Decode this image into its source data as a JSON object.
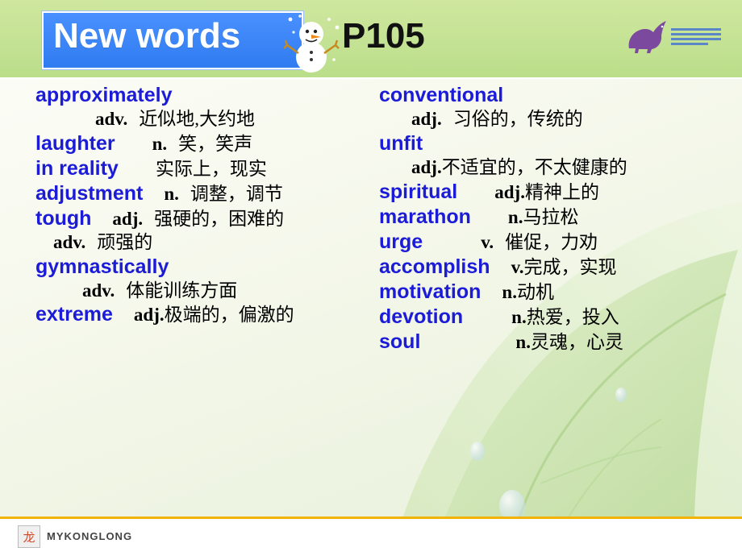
{
  "header": {
    "title": "New words",
    "page_ref": "P105",
    "title_box_color": "#3b83f6",
    "band_color": "#c9e49a",
    "snowman_icon": "snowman-icon",
    "dino_icon": "dinosaur-icon"
  },
  "columns": {
    "left": [
      {
        "word": "approximately",
        "lines": [
          {
            "pos": "adv.",
            "cn": "近似地,大约地",
            "indent": "indent-line"
          }
        ]
      },
      {
        "word": "laughter",
        "pos": "n.",
        "cn": "笑，笑声",
        "inline": true
      },
      {
        "word": "in reality",
        "pos": "",
        "cn": "实际上，现实",
        "inline": true
      },
      {
        "word": "adjustment",
        "pos": "n.",
        "cn": "调整，调节",
        "inline": true
      },
      {
        "word": "tough",
        "pos": "adj.",
        "cn": "强硬的，困难的",
        "inline": true,
        "lines": [
          {
            "pos": "adv.",
            "cn": "顽强的",
            "indent": "indent-line-4"
          }
        ]
      },
      {
        "word": "gymnastically",
        "lines": [
          {
            "pos": "adv.",
            "cn": "体能训练方面",
            "indent": "indent-line-3"
          }
        ]
      },
      {
        "word": "extreme",
        "pos": "adj.",
        "cn": "极端的，偏激的",
        "inline": true
      }
    ],
    "right": [
      {
        "word": "conventional",
        "lines": [
          {
            "pos": "adj.",
            "cn": "习俗的，传统的",
            "indent": "indent-line-2"
          }
        ]
      },
      {
        "word": "unfit",
        "lines": [
          {
            "pos": "adj.",
            "cn": "不适宜的，不太健康的",
            "indent": "indent-line-2"
          }
        ]
      },
      {
        "word": "spiritual",
        "pos": "adj.",
        "cn": "精神上的",
        "inline": true
      },
      {
        "word": "marathon",
        "pos": "n.",
        "cn": "马拉松",
        "inline": true
      },
      {
        "word": "urge",
        "pos": "v.",
        "cn": "催促，力劝",
        "inline": true
      },
      {
        "word": "accomplish",
        "pos": "v.",
        "cn": "完成，实现",
        "inline": true
      },
      {
        "word": "motivation",
        "pos": "n.",
        "cn": "动机",
        "inline": true
      },
      {
        "word": "devotion",
        "pos": "n.",
        "cn": "热爱，投入",
        "inline": true
      },
      {
        "word": "soul",
        "pos": "n.",
        "cn": "灵魂，心灵",
        "inline": true
      }
    ]
  },
  "entries_left": {
    "e0_word": "approximately",
    "e0_pos": "adv.",
    "e0_cn": "近似地,大约地",
    "e1_word": "laughter",
    "e1_pos": "n.",
    "e1_cn": "笑，笑声",
    "e2_word": "in reality",
    "e2_cn": "实际上，现实",
    "e3_word": "adjustment",
    "e3_pos": "n.",
    "e3_cn": "调整，调节",
    "e4_word": "tough",
    "e4_pos": "adj.",
    "e4_cn": "强硬的，困难的",
    "e4b_pos": "adv.",
    "e4b_cn": "顽强的",
    "e5_word": "gymnastically",
    "e5_pos": "adv.",
    "e5_cn": "体能训练方面",
    "e6_word": "extreme",
    "e6_pos": "adj.",
    "e6_cn": "极端的，偏激的"
  },
  "entries_right": {
    "r0_word": "conventional",
    "r0_pos": "adj.",
    "r0_cn": "习俗的，传统的",
    "r1_word": "unfit",
    "r1_pos": "adj.",
    "r1_cn": "不适宜的，不太健康的",
    "r2_word": "spiritual",
    "r2_pos": "adj.",
    "r2_cn": "精神上的",
    "r3_word": "marathon",
    "r3_pos": "n.",
    "r3_cn": "马拉松",
    "r4_word": "urge",
    "r4_pos": "v.",
    "r4_cn": "催促，力劝",
    "r5_word": "accomplish",
    "r5_pos": "v.",
    "r5_cn": "完成，实现",
    "r6_word": "motivation",
    "r6_pos": "n.",
    "r6_cn": "动机",
    "r7_word": "devotion",
    "r7_pos": "n.",
    "r7_cn": "热爱，投入",
    "r8_word": "soul",
    "r8_pos": "n.",
    "r8_cn": "灵魂，心灵"
  },
  "footer": {
    "brand": "MYKONGLONG",
    "logo_glyph": "龙",
    "accent_color": "#f2b200"
  }
}
